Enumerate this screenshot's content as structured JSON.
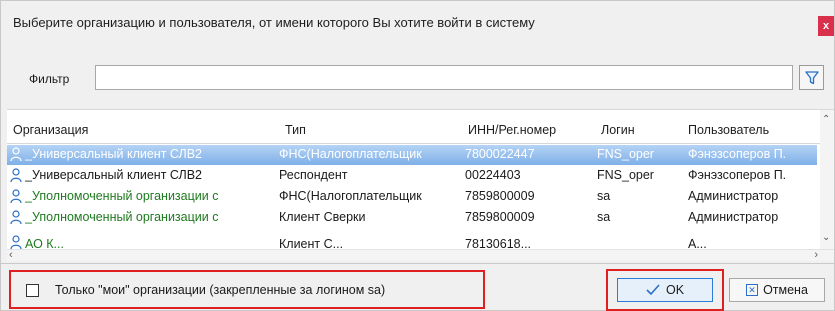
{
  "window": {
    "title": "Выберите организацию и пользователя, от имени которого Вы хотите войти в систему",
    "close_glyph": "x"
  },
  "filter": {
    "label": "Фильтр",
    "value": ""
  },
  "grid": {
    "columns": [
      "Организация",
      "Тип",
      "ИНН/Рег.номер",
      "Логин",
      "Пользователь"
    ],
    "rows": [
      {
        "org": "_Универсальный клиент СЛВ2",
        "type": "ФНС(Налогоплательщик",
        "inn": "7800022447",
        "login": "FNS_oper",
        "user": "Фэнэзсоперов П.",
        "selected": true,
        "org_color": "#ffffff"
      },
      {
        "org": "_Универсальный клиент СЛВ2",
        "type": "Респондент",
        "inn": "00224403",
        "login": "FNS_oper",
        "user": "Фэнэзсоперов П.",
        "selected": false,
        "org_color": "#1a1a1a"
      },
      {
        "org": "_Уполномоченный организации с",
        "type": "ФНС(Налогоплательщик",
        "inn": "7859800009",
        "login": "sa",
        "user": "Администратор",
        "selected": false,
        "org_color": "#1f7a1f"
      },
      {
        "org": "_Уполномоченный организации с",
        "type": "Клиент Сверки",
        "inn": "7859800009",
        "login": "sa",
        "user": "Администратор",
        "selected": false,
        "org_color": "#1f7a1f"
      },
      {
        "org": "АО К...",
        "type": "Клиент С...",
        "inn": "78130618...",
        "login": "",
        "user": "А...",
        "selected": false,
        "org_color": "#1f7a1f"
      }
    ]
  },
  "only_mine": {
    "label": "Только \"мои\" организации (закрепленные за логином sa)",
    "checked": false
  },
  "buttons": {
    "ok_label": "OK",
    "cancel_label": "Отмена"
  },
  "colors": {
    "selection": "#7fb0e8",
    "highlight_frame": "#e02020",
    "ok_border": "#2b7bd9"
  }
}
